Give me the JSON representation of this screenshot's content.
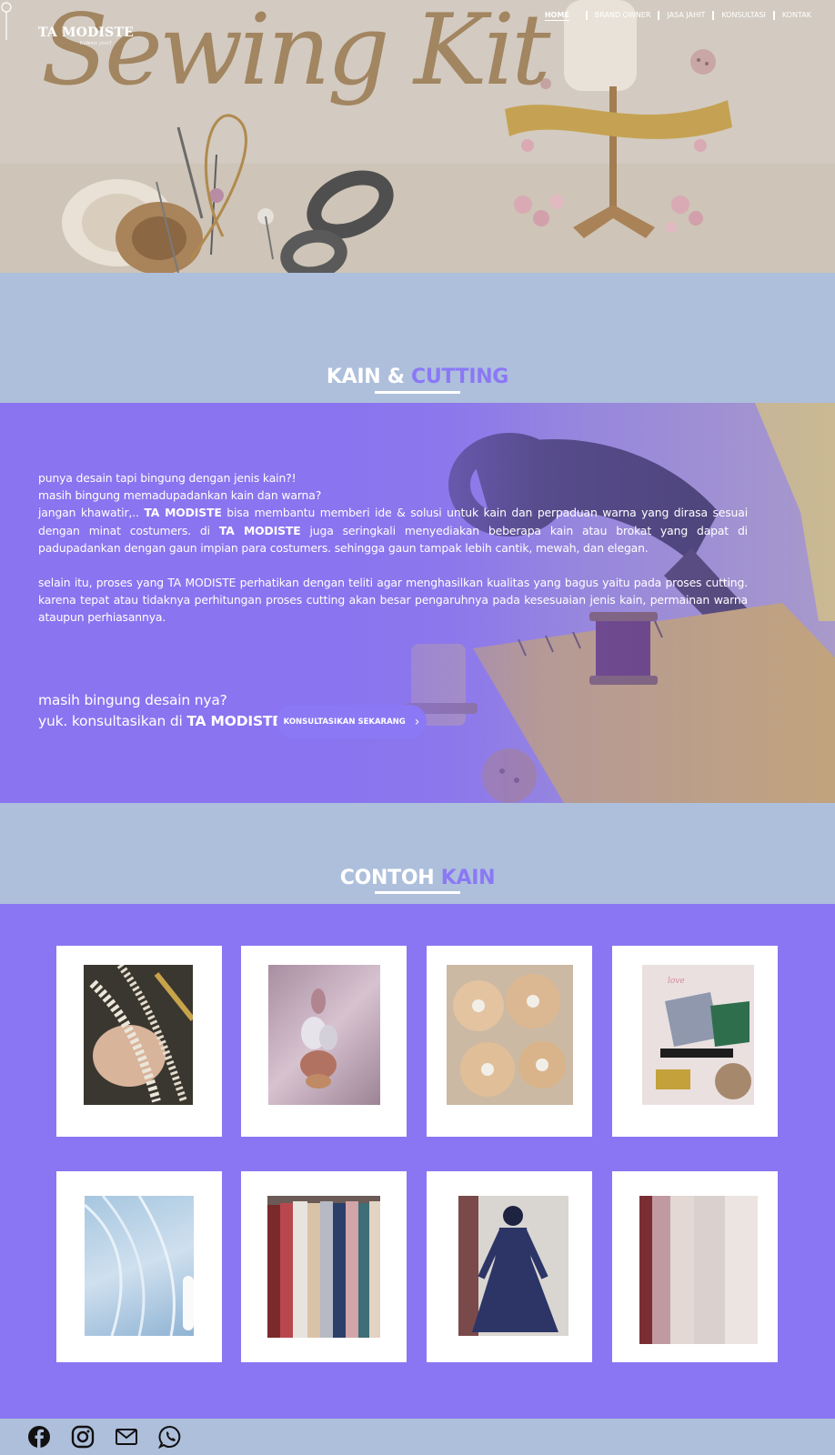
{
  "brand": {
    "name": "TA MODISTE",
    "tagline": "RUMAH JAHIT"
  },
  "hero": {
    "script_title": "Sewing Kit"
  },
  "nav": {
    "items": [
      {
        "label": "HOME",
        "active": true
      },
      {
        "label": "BRAND OWNER",
        "active": false
      },
      {
        "label": "JASA JAHIT",
        "active": false
      },
      {
        "label": "KONSULTASI",
        "active": false
      },
      {
        "label": "KONTAK",
        "active": false
      }
    ]
  },
  "section1": {
    "title_white": "KAIN &",
    "title_purple": "CUTTING",
    "line1": "punya desain tapi bingung dengan jenis kain?!",
    "line2": "masih bingung memadupadankan kain dan warna?",
    "p3_a": "jangan khawatir,.. ",
    "p3_b": "TA MODISTE",
    "p3_c": " bisa membantu memberi ide & solusi untuk kain dan perpaduan warna yang dirasa sesuai dengan minat costumers. di ",
    "p3_d": "TA MODISTE",
    "p3_e": " juga seringkali menyediakan beberapa kain atau brokat yang dapat di padupadankan dengan gaun impian para costumers. sehingga gaun tampak lebih cantik, mewah, dan elegan.",
    "p4": "selain itu, proses yang TA MODISTE perhatikan dengan teliti agar menghasilkan kualitas yang bagus yaitu pada proses cutting. karena tepat atau tidaknya perhitungan proses cutting akan besar pengaruhnya pada kesesuaian jenis kain, permainan warna ataupun perhiasannya.",
    "cta_line1": "masih bingung desain nya?",
    "cta_line2a": "yuk. konsultasikan di ",
    "cta_line2b": "TA MODISTE",
    "cta_button": "KONSULTASIKAN SEKARANG"
  },
  "section2": {
    "title_white": "CONTOH",
    "title_purple": "KAIN",
    "images": [
      {
        "name": "pearl-lace-photo",
        "caption": ""
      },
      {
        "name": "crystal-applique-photo",
        "caption": ""
      },
      {
        "name": "flower-pearl-applique-photo",
        "caption": ""
      },
      {
        "name": "custom-mask-promo-photo",
        "caption": ""
      },
      {
        "name": "light-blue-glitter-tulle-photo",
        "caption": ""
      },
      {
        "name": "fabric-rolls-photo",
        "caption": ""
      },
      {
        "name": "navy-gown-photo",
        "caption": ""
      },
      {
        "name": "sequin-fabric-photo",
        "caption": ""
      }
    ]
  },
  "footer": {
    "icons": [
      "facebook-icon",
      "instagram-icon",
      "mail-icon",
      "whatsapp-icon"
    ]
  },
  "colors": {
    "accent": "#8b78f5",
    "band": "#adbfdb",
    "gallery_bg": "#8a76f2",
    "white": "#ffffff"
  }
}
